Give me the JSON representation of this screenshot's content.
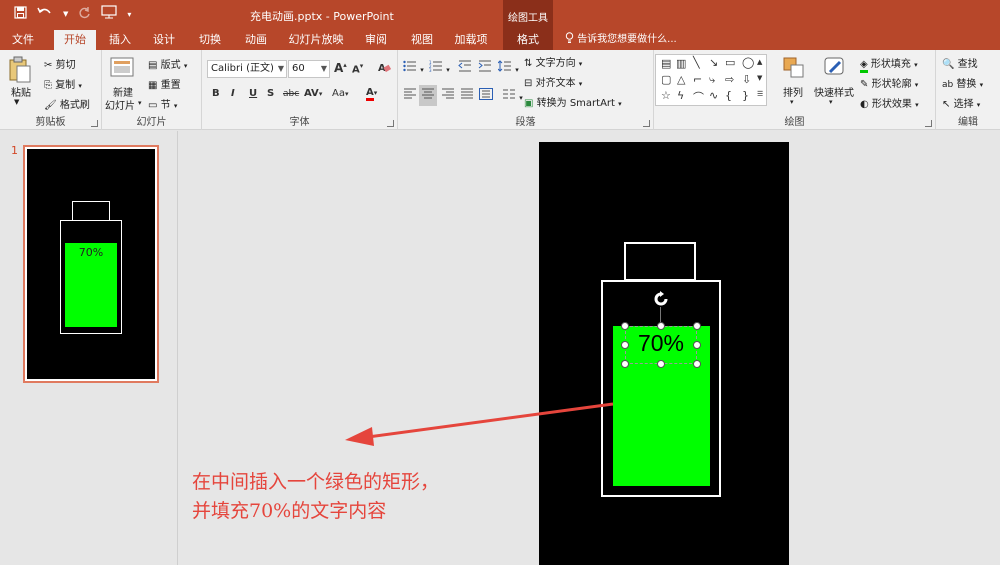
{
  "app": {
    "title": "充电动画.pptx - PowerPoint",
    "context_tool": "绘图工具",
    "qat": [
      "save-icon",
      "undo-icon",
      "redo-icon",
      "start-from-beginning-icon",
      "customize-qat-icon"
    ]
  },
  "tabs": [
    {
      "label": "文件"
    },
    {
      "label": "开始",
      "active": true
    },
    {
      "label": "插入"
    },
    {
      "label": "设计"
    },
    {
      "label": "切换"
    },
    {
      "label": "动画"
    },
    {
      "label": "幻灯片放映"
    },
    {
      "label": "审阅"
    },
    {
      "label": "视图"
    },
    {
      "label": "加载项"
    },
    {
      "label": "格式"
    }
  ],
  "tell_me": "告诉我您想要做什么...",
  "ribbon": {
    "clipboard": {
      "paste": "粘贴",
      "cut": "剪切",
      "copy": "复制",
      "format_painter": "格式刷",
      "label": "剪贴板"
    },
    "slides": {
      "new_slide_line1": "新建",
      "new_slide_line2": "幻灯片",
      "layout": "版式",
      "reset": "重置",
      "section": "节",
      "label": "幻灯片"
    },
    "font": {
      "font_name": "Calibri (正文)",
      "font_size": "60",
      "label": "字体",
      "bold": "B",
      "italic": "I",
      "underline": "U",
      "shadow": "S",
      "strike": "abc",
      "spacing": "AV",
      "case": "Aa",
      "color": "A",
      "grow": "A",
      "shrink": "A"
    },
    "paragraph": {
      "text_direction": "文字方向",
      "align_text": "对齐文本",
      "smartart": "转换为 SmartArt",
      "label": "段落"
    },
    "drawing": {
      "arrange": "排列",
      "quick_styles": "快速样式",
      "shape_fill": "形状填充",
      "shape_outline": "形状轮廓",
      "shape_effects": "形状效果",
      "label": "绘图"
    },
    "editing": {
      "find": "查找",
      "replace": "替换",
      "select": "选择",
      "label": "编辑"
    }
  },
  "slides_pane": {
    "number": "1",
    "thumb_text": "70%"
  },
  "slide": {
    "battery_text": "70%",
    "level_percent": 70
  },
  "annotation": {
    "line1": "在中间插入一个绿色的矩形，",
    "line2": "并填充70%的文字内容"
  },
  "colors": {
    "accent": "#b7472a",
    "battery_fill": "#00ff00",
    "annotation": "#e5453c"
  }
}
